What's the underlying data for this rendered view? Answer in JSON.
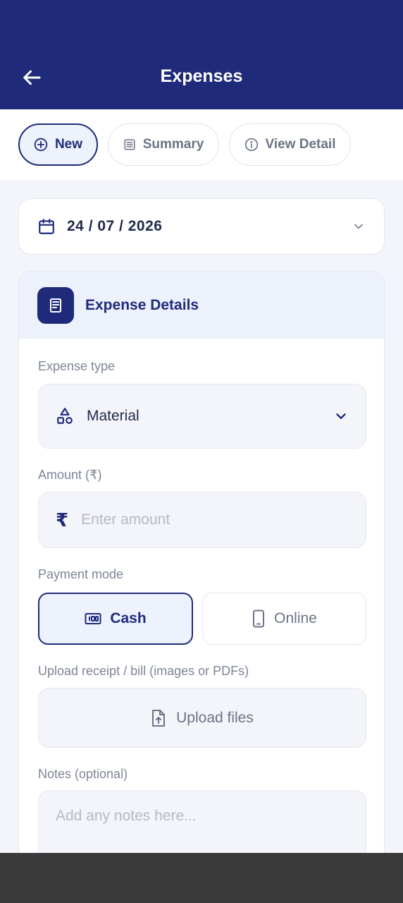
{
  "header": {
    "title": "Expenses",
    "back_icon": "arrow-left-icon"
  },
  "tabs": [
    {
      "label": "New",
      "icon": "plus-circle-icon",
      "active": true
    },
    {
      "label": "Summary",
      "icon": "list-icon",
      "active": false
    },
    {
      "label": "View Detail",
      "icon": "info-icon",
      "active": false
    }
  ],
  "date_picker": {
    "value": "24 / 07 / 2026",
    "icon": "calendar-icon"
  },
  "expense_details": {
    "title": "Expense Details",
    "icon": "receipt-icon",
    "expense_type": {
      "label": "Expense type",
      "value": "Material",
      "icon": "shapes-icon"
    },
    "amount": {
      "label": "Amount (₹)",
      "placeholder": "Enter amount",
      "currency_symbol": "₹"
    },
    "payment_mode": {
      "label": "Payment mode",
      "options": [
        {
          "label": "Cash",
          "icon": "cash-icon",
          "selected": true
        },
        {
          "label": "Online",
          "icon": "phone-icon",
          "selected": false
        }
      ]
    },
    "upload": {
      "label": "Upload receipt / bill (images or PDFs)",
      "button_label": "Upload files",
      "icon": "file-upload-icon"
    },
    "notes": {
      "label": "Notes (optional)",
      "placeholder": "Add any notes here..."
    }
  },
  "colors": {
    "primary": "#1f2b7a",
    "background": "#f3f5fa",
    "accent_light": "#ecf1fc",
    "muted_text": "#7d8596"
  }
}
